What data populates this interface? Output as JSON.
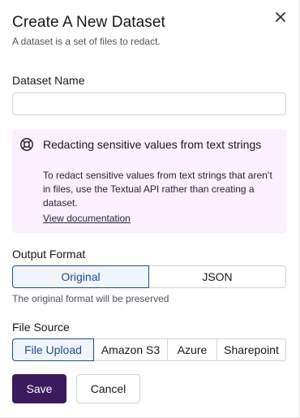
{
  "dialog": {
    "title": "Create A New Dataset",
    "subtitle": "A dataset is a set of files to redact.",
    "close_icon": "close-icon"
  },
  "dataset_name": {
    "label": "Dataset Name",
    "value": "",
    "placeholder": ""
  },
  "info": {
    "icon": "lifebuoy-icon",
    "title": "Redacting sensitive values from text strings",
    "body": "To redact sensitive values from text strings that aren’t in files, use the Textual API rather than creating a dataset.",
    "link": "View documentation"
  },
  "output_format": {
    "label": "Output Format",
    "options": [
      "Original",
      "JSON"
    ],
    "selected": "Original",
    "hint": "The original format will be preserved"
  },
  "file_source": {
    "label": "File Source",
    "options": [
      "File Upload",
      "Amazon S3",
      "Azure",
      "Sharepoint"
    ],
    "selected": "File Upload"
  },
  "actions": {
    "save": "Save",
    "cancel": "Cancel"
  },
  "colors": {
    "primary": "#3b1a5e",
    "selected_border": "#1d4e89",
    "info_bg": "#faf0fe"
  }
}
